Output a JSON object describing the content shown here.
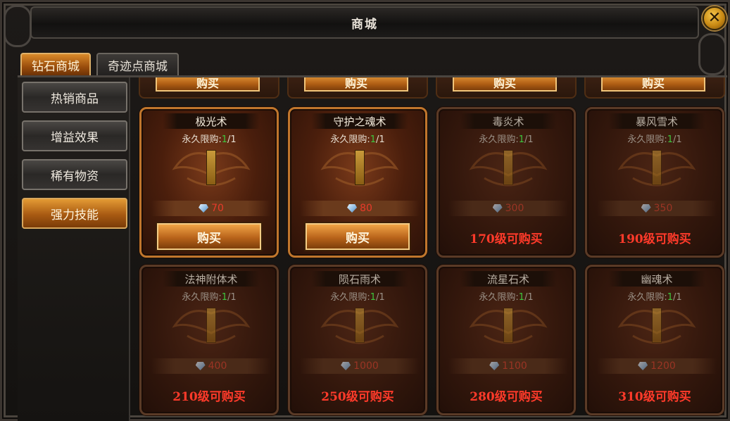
{
  "window": {
    "title": "商城",
    "close_label": "✕"
  },
  "tabs": [
    {
      "label": "钻石商城",
      "active": true
    },
    {
      "label": "奇迹点商城",
      "active": false
    }
  ],
  "sidebar": {
    "items": [
      {
        "label": "热销商品",
        "active": false
      },
      {
        "label": "增益效果",
        "active": false
      },
      {
        "label": "稀有物资",
        "active": false
      },
      {
        "label": "强力技能",
        "active": true
      }
    ]
  },
  "top_row_stub_label": "购买",
  "limit_label": {
    "prefix": "永久限购:",
    "current": "1",
    "sep": "/",
    "max": "1"
  },
  "currency_icon": "diamond-icon",
  "items": [
    {
      "name": "极光术",
      "price": "70",
      "available": true,
      "action": "购买"
    },
    {
      "name": "守护之魂术",
      "price": "80",
      "available": true,
      "action": "购买"
    },
    {
      "name": "毒炎术",
      "price": "300",
      "available": false,
      "action": "170级可购买"
    },
    {
      "name": "暴风雪术",
      "price": "350",
      "available": false,
      "action": "190级可购买"
    },
    {
      "name": "法神附体术",
      "price": "400",
      "available": false,
      "action": "210级可购买"
    },
    {
      "name": "陨石雨术",
      "price": "1000",
      "available": false,
      "action": "250级可购买"
    },
    {
      "name": "流星石术",
      "price": "1100",
      "available": false,
      "action": "280级可购买"
    },
    {
      "name": "幽魂术",
      "price": "1200",
      "available": false,
      "action": "310级可购买"
    }
  ],
  "colors": {
    "accent": "#d98a2a",
    "level_text": "#ff3a2a",
    "price": "#e83a2a",
    "limit_count": "#3ec63e"
  }
}
